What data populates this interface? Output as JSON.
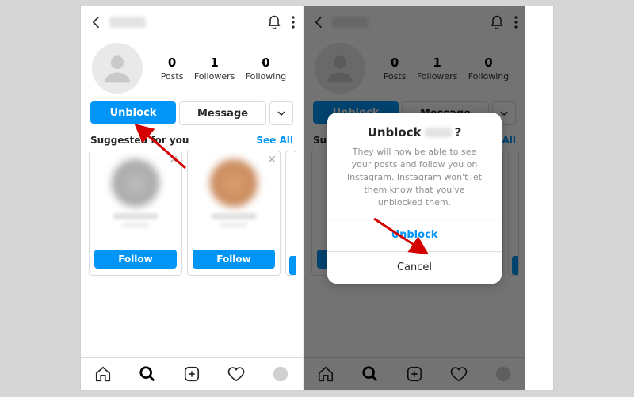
{
  "stats": {
    "posts": {
      "num": "0",
      "label": "Posts"
    },
    "followers": {
      "num": "1",
      "label": "Followers"
    },
    "following": {
      "num": "0",
      "label": "Following"
    }
  },
  "buttons": {
    "unblock": "Unblock",
    "message": "Message",
    "follow": "Follow"
  },
  "suggested": {
    "title": "Suggested for you",
    "see_all": "See All"
  },
  "dialog": {
    "title_prefix": "Unblock",
    "title_suffix": "?",
    "message": "They will now be able to see your posts and follow you on Instagram. Instagram won't let them know that you've unblocked them.",
    "confirm": "Unblock",
    "cancel": "Cancel"
  }
}
